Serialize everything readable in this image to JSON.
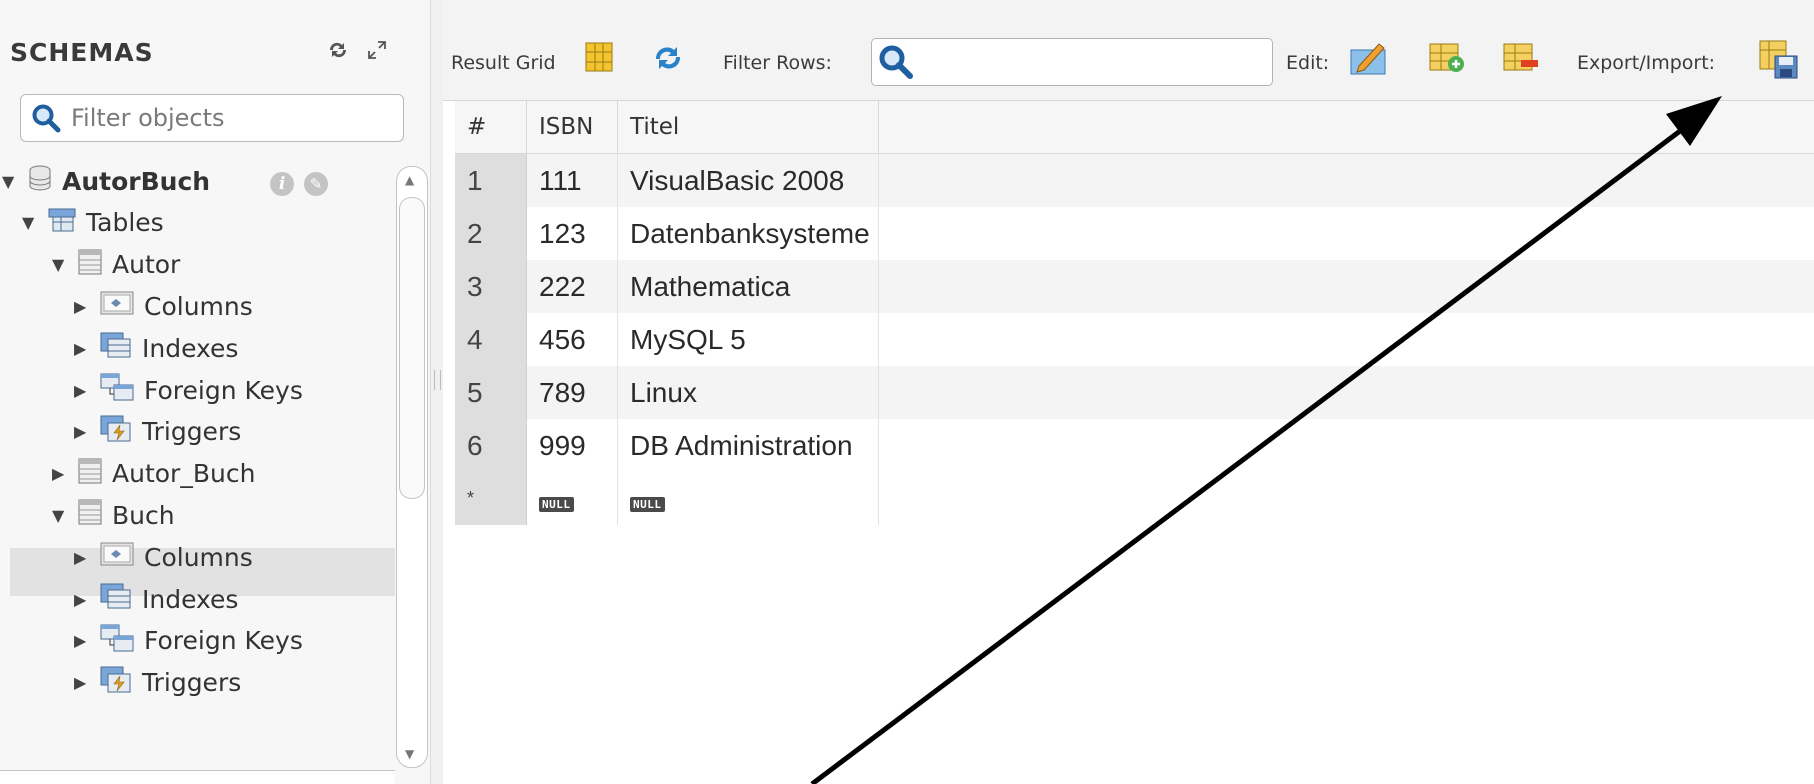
{
  "schemas_panel": {
    "title": "SCHEMAS",
    "filter_placeholder": "Filter objects",
    "tree": [
      {
        "label": "AutorBuch",
        "level": 0,
        "bold": true,
        "icon": "database-icon",
        "expanded": true
      },
      {
        "label": "Tables",
        "level": 1,
        "icon": "tables-folder-icon",
        "expanded": true
      },
      {
        "label": "Autor",
        "level": 2,
        "icon": "table-icon",
        "expanded": true
      },
      {
        "label": "Columns",
        "level": 3,
        "icon": "columns-icon",
        "expanded": false
      },
      {
        "label": "Indexes",
        "level": 3,
        "icon": "indexes-icon",
        "expanded": false
      },
      {
        "label": "Foreign Keys",
        "level": 3,
        "icon": "foreign-keys-icon",
        "expanded": false
      },
      {
        "label": "Triggers",
        "level": 3,
        "icon": "triggers-icon",
        "expanded": false
      },
      {
        "label": "Autor_Buch",
        "level": 2,
        "icon": "table-icon",
        "expanded": false
      },
      {
        "label": "Buch",
        "level": 2,
        "icon": "table-icon",
        "expanded": true,
        "selected": true
      },
      {
        "label": "Columns",
        "level": 3,
        "icon": "columns-icon",
        "expanded": false
      },
      {
        "label": "Indexes",
        "level": 3,
        "icon": "indexes-icon",
        "expanded": false
      },
      {
        "label": "Foreign Keys",
        "level": 3,
        "icon": "foreign-keys-icon",
        "expanded": false
      },
      {
        "label": "Triggers",
        "level": 3,
        "icon": "triggers-icon",
        "expanded": false
      }
    ]
  },
  "toolbar": {
    "result_grid_label": "Result Grid",
    "filter_rows_label": "Filter Rows:",
    "filter_rows_value": "",
    "edit_label": "Edit:",
    "export_import_label": "Export/Import:"
  },
  "grid": {
    "columns": [
      "#",
      "ISBN",
      "Titel"
    ],
    "rows": [
      {
        "num": "1",
        "isbn": "111",
        "titel": "VisualBasic 2008"
      },
      {
        "num": "2",
        "isbn": "123",
        "titel": "Datenbanksysteme"
      },
      {
        "num": "3",
        "isbn": "222",
        "titel": "Mathematica"
      },
      {
        "num": "4",
        "isbn": "456",
        "titel": "MySQL 5"
      },
      {
        "num": "5",
        "isbn": "789",
        "titel": "Linux"
      },
      {
        "num": "6",
        "isbn": "999",
        "titel": "DB Administration"
      }
    ],
    "new_row": {
      "num": "*",
      "isbn": "NULL",
      "titel": "NULL"
    }
  },
  "colors": {
    "accent_blue": "#2a6fb5",
    "selection": "#e2e2e2",
    "annotation_arrow": "#000000"
  }
}
